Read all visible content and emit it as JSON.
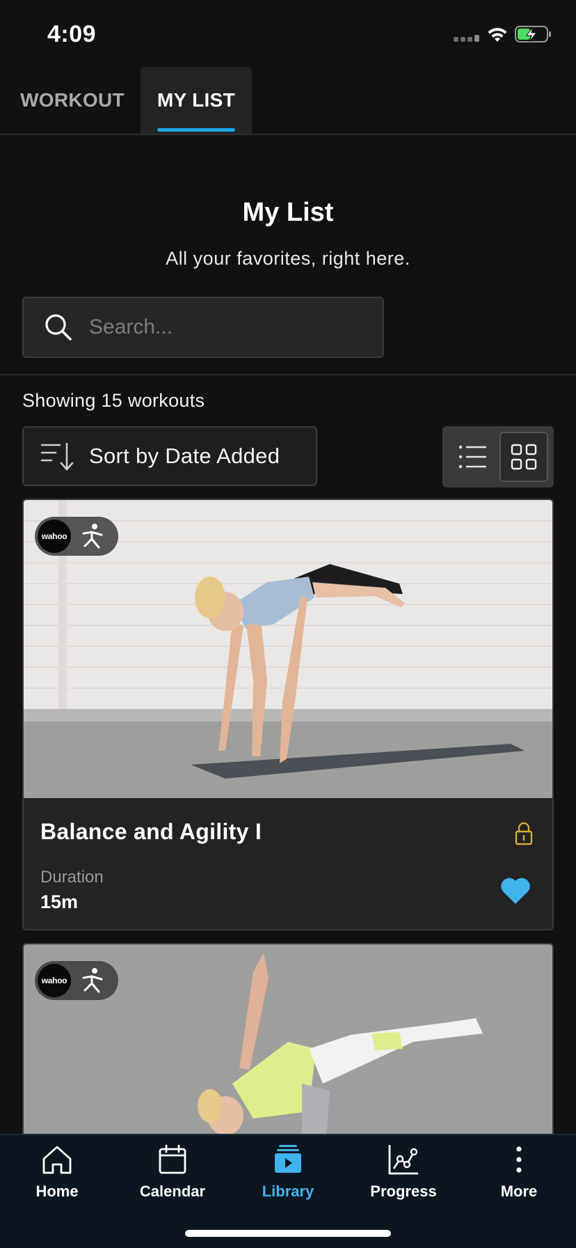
{
  "status_bar": {
    "time": "4:09"
  },
  "tabs": [
    {
      "label": "WORKOUT",
      "active": false
    },
    {
      "label": "MY LIST",
      "active": true
    }
  ],
  "header": {
    "title": "My List",
    "subtitle": "All your favorites, right here."
  },
  "search": {
    "placeholder": "Search...",
    "value": ""
  },
  "results": {
    "count_text": "Showing 15 workouts"
  },
  "sort": {
    "label": "Sort by Date Added"
  },
  "view_toggle": {
    "selected": "grid"
  },
  "workouts": [
    {
      "title": "Balance and Agility I",
      "duration_label": "Duration",
      "duration": "15m",
      "locked": true,
      "favorite": true,
      "badge_logo": "wahoo"
    },
    {
      "badge_logo": "wahoo"
    }
  ],
  "bottom_nav": [
    {
      "label": "Home",
      "icon": "home-icon",
      "active": false
    },
    {
      "label": "Calendar",
      "icon": "calendar-icon",
      "active": false
    },
    {
      "label": "Library",
      "icon": "library-icon",
      "active": true
    },
    {
      "label": "Progress",
      "icon": "progress-icon",
      "active": false
    },
    {
      "label": "More",
      "icon": "more-icon",
      "active": false
    }
  ],
  "colors": {
    "accent": "#1ea7e8",
    "favorite": "#3fb3ec",
    "lock": "#d8a933",
    "background": "#111111",
    "nav_background": "#0c1620"
  }
}
